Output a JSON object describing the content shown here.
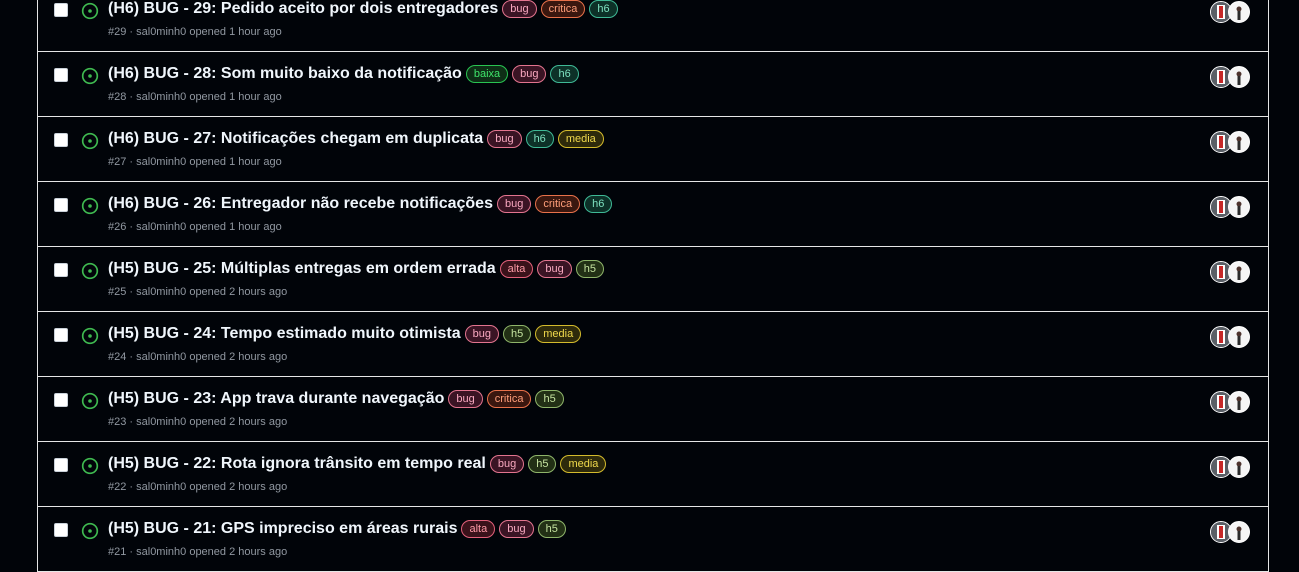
{
  "issues": [
    {
      "title": "(H6) BUG - 29: Pedido aceito por dois entregadores",
      "meta": "#29 · sal0minh0 opened 1 hour ago",
      "labels": [
        {
          "text": "bug",
          "kind": "bug"
        },
        {
          "text": "critica",
          "kind": "critica"
        },
        {
          "text": "h6",
          "kind": "h6"
        }
      ]
    },
    {
      "title": "(H6) BUG - 28: Som muito baixo da notificação",
      "meta": "#28 · sal0minh0 opened 1 hour ago",
      "labels": [
        {
          "text": "baixa",
          "kind": "baixa"
        },
        {
          "text": "bug",
          "kind": "bug"
        },
        {
          "text": "h6",
          "kind": "h6"
        }
      ]
    },
    {
      "title": "(H6) BUG - 27: Notificações chegam em duplicata",
      "meta": "#27 · sal0minh0 opened 1 hour ago",
      "labels": [
        {
          "text": "bug",
          "kind": "bug"
        },
        {
          "text": "h6",
          "kind": "h6"
        },
        {
          "text": "media",
          "kind": "media"
        }
      ]
    },
    {
      "title": "(H6) BUG - 26: Entregador não recebe notificações",
      "meta": "#26 · sal0minh0 opened 1 hour ago",
      "labels": [
        {
          "text": "bug",
          "kind": "bug"
        },
        {
          "text": "critica",
          "kind": "critica"
        },
        {
          "text": "h6",
          "kind": "h6"
        }
      ]
    },
    {
      "title": "(H5) BUG - 25: Múltiplas entregas em ordem errada",
      "meta": "#25 · sal0minh0 opened 2 hours ago",
      "labels": [
        {
          "text": "alta",
          "kind": "alta"
        },
        {
          "text": "bug",
          "kind": "bug"
        },
        {
          "text": "h5",
          "kind": "h5"
        }
      ]
    },
    {
      "title": "(H5) BUG - 24: Tempo estimado muito otimista",
      "meta": "#24 · sal0minh0 opened 2 hours ago",
      "labels": [
        {
          "text": "bug",
          "kind": "bug"
        },
        {
          "text": "h5",
          "kind": "h5"
        },
        {
          "text": "media",
          "kind": "media"
        }
      ]
    },
    {
      "title": "(H5) BUG - 23: App trava durante navegação",
      "meta": "#23 · sal0minh0 opened 2 hours ago",
      "labels": [
        {
          "text": "bug",
          "kind": "bug"
        },
        {
          "text": "critica",
          "kind": "critica"
        },
        {
          "text": "h5",
          "kind": "h5"
        }
      ]
    },
    {
      "title": "(H5) BUG - 22: Rota ignora trânsito em tempo real",
      "meta": "#22 · sal0minh0 opened 2 hours ago",
      "labels": [
        {
          "text": "bug",
          "kind": "bug"
        },
        {
          "text": "h5",
          "kind": "h5"
        },
        {
          "text": "media",
          "kind": "media"
        }
      ]
    },
    {
      "title": "(H5) BUG - 21: GPS impreciso em áreas rurais",
      "meta": "#21 · sal0minh0 opened 2 hours ago",
      "labels": [
        {
          "text": "alta",
          "kind": "alta"
        },
        {
          "text": "bug",
          "kind": "bug"
        },
        {
          "text": "h5",
          "kind": "h5"
        }
      ]
    }
  ],
  "icons": {
    "status": "issue-opened-icon",
    "assignees": "avatar-icon"
  },
  "colors": {
    "open_status": "#3fb950",
    "background": "#010409",
    "title": "#f0f6fc",
    "meta": "#9198a1"
  }
}
